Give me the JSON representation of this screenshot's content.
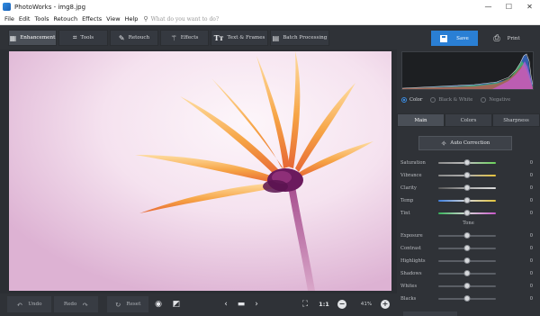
{
  "window": {
    "title": "PhotoWorks - img8.jpg",
    "controls": {
      "minimize": "—",
      "maximize": "☐",
      "close": "✕"
    }
  },
  "menu": {
    "items": [
      "File",
      "Edit",
      "Tools",
      "Retouch",
      "Effects",
      "View",
      "Help"
    ],
    "search_placeholder": "What do you want to do?"
  },
  "toolbar": {
    "tabs": [
      {
        "label": "Enhancement",
        "icon": "enhancement-icon",
        "active": true
      },
      {
        "label": "Tools",
        "icon": "crop-icon",
        "active": false
      },
      {
        "label": "Retouch",
        "icon": "brush-icon",
        "active": false
      },
      {
        "label": "Effects",
        "icon": "wand-icon",
        "active": false
      },
      {
        "label": "Text & Frames",
        "icon": "text-icon",
        "active": false
      },
      {
        "label": "Batch Processing",
        "icon": "batch-icon",
        "active": false
      }
    ],
    "save_label": "Save",
    "print_label": "Print"
  },
  "bottom": {
    "undo_label": "Undo",
    "redo_label": "Redo",
    "reset_label": "Reset",
    "scale_label": "1:1",
    "zoom": "41%"
  },
  "panel": {
    "modes": [
      {
        "label": "Color",
        "selected": true
      },
      {
        "label": "Black & White",
        "selected": false
      },
      {
        "label": "Negative",
        "selected": false
      }
    ],
    "tabs": [
      {
        "label": "Main",
        "active": true
      },
      {
        "label": "Colors",
        "active": false
      },
      {
        "label": "Sharpness",
        "active": false
      }
    ],
    "auto_correction_label": "Auto Correction",
    "color_sliders": [
      {
        "label": "Saturation",
        "value": 0,
        "level": 0.5
      },
      {
        "label": "Vibrance",
        "value": 0,
        "level": 0.5
      },
      {
        "label": "Clarity",
        "value": 0,
        "level": 0.5
      },
      {
        "label": "Temp",
        "value": 0,
        "level": 0.5
      },
      {
        "label": "Tint",
        "value": 0,
        "level": 0.5
      }
    ],
    "tone_heading": "Tone",
    "tone_sliders": [
      {
        "label": "Exposure",
        "value": 0,
        "level": 0.5
      },
      {
        "label": "Contrast",
        "value": 0,
        "level": 0.5
      },
      {
        "label": "Highlights",
        "value": 0,
        "level": 0.5
      },
      {
        "label": "Shadows",
        "value": 0,
        "level": 0.5
      },
      {
        "label": "Whites",
        "value": 0,
        "level": 0.5
      },
      {
        "label": "Blacks",
        "value": 0,
        "level": 0.5
      }
    ]
  },
  "colors": {
    "accent": "#2a7fd4",
    "panel_bg": "#2f3237"
  }
}
